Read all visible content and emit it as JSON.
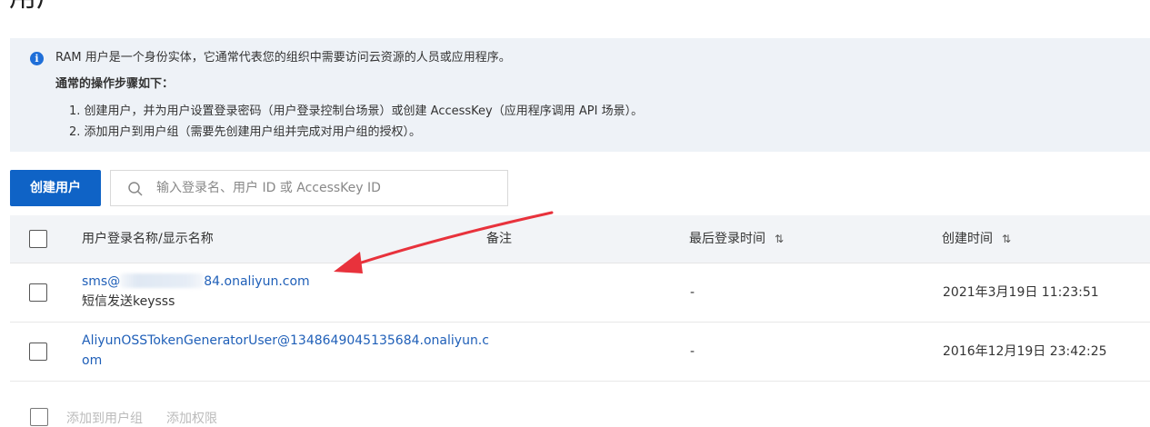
{
  "page": {
    "title": "用户"
  },
  "info": {
    "intro": "RAM 用户是一个身份实体，它通常代表您的组织中需要访问云资源的人员或应用程序。",
    "steps_title": "通常的操作步骤如下：",
    "steps": [
      "1. 创建用户，并为用户设置登录密码（用户登录控制台场景）或创建 AccessKey（应用程序调用 API 场景）。",
      "2. 添加用户到用户组（需要先创建用户组并完成对用户组的授权）。"
    ]
  },
  "toolbar": {
    "create_label": "创建用户",
    "search_placeholder": "输入登录名、用户 ID 或 AccessKey ID"
  },
  "table": {
    "columns": {
      "name": "用户登录名称/显示名称",
      "note": "备注",
      "last_login": "最后登录时间",
      "created": "创建时间"
    },
    "sort_icon": "⇅",
    "rows": [
      {
        "login_prefix": "sms@",
        "login_suffix": "84.onaliyun.com",
        "display_name": "短信发送keysss",
        "last_login": "-",
        "created": "2021年3月19日 11:23:51"
      },
      {
        "login_line1": "AliyunOSSTokenGeneratorUser@1348649045135684.onaliyun.c",
        "login_line2": "om",
        "last_login": "-",
        "created": "2016年12月19日 23:42:25"
      }
    ]
  },
  "footer": {
    "add_to_group": "添加到用户组",
    "add_permission": "添加权限"
  },
  "colors": {
    "primary": "#0f63c6",
    "link": "#1f5fb8",
    "annotation_arrow": "#e8323c",
    "info_bg": "#eef2f7"
  },
  "icons": {
    "info": "info-icon",
    "search": "search-icon",
    "sort": "sort-icon"
  }
}
